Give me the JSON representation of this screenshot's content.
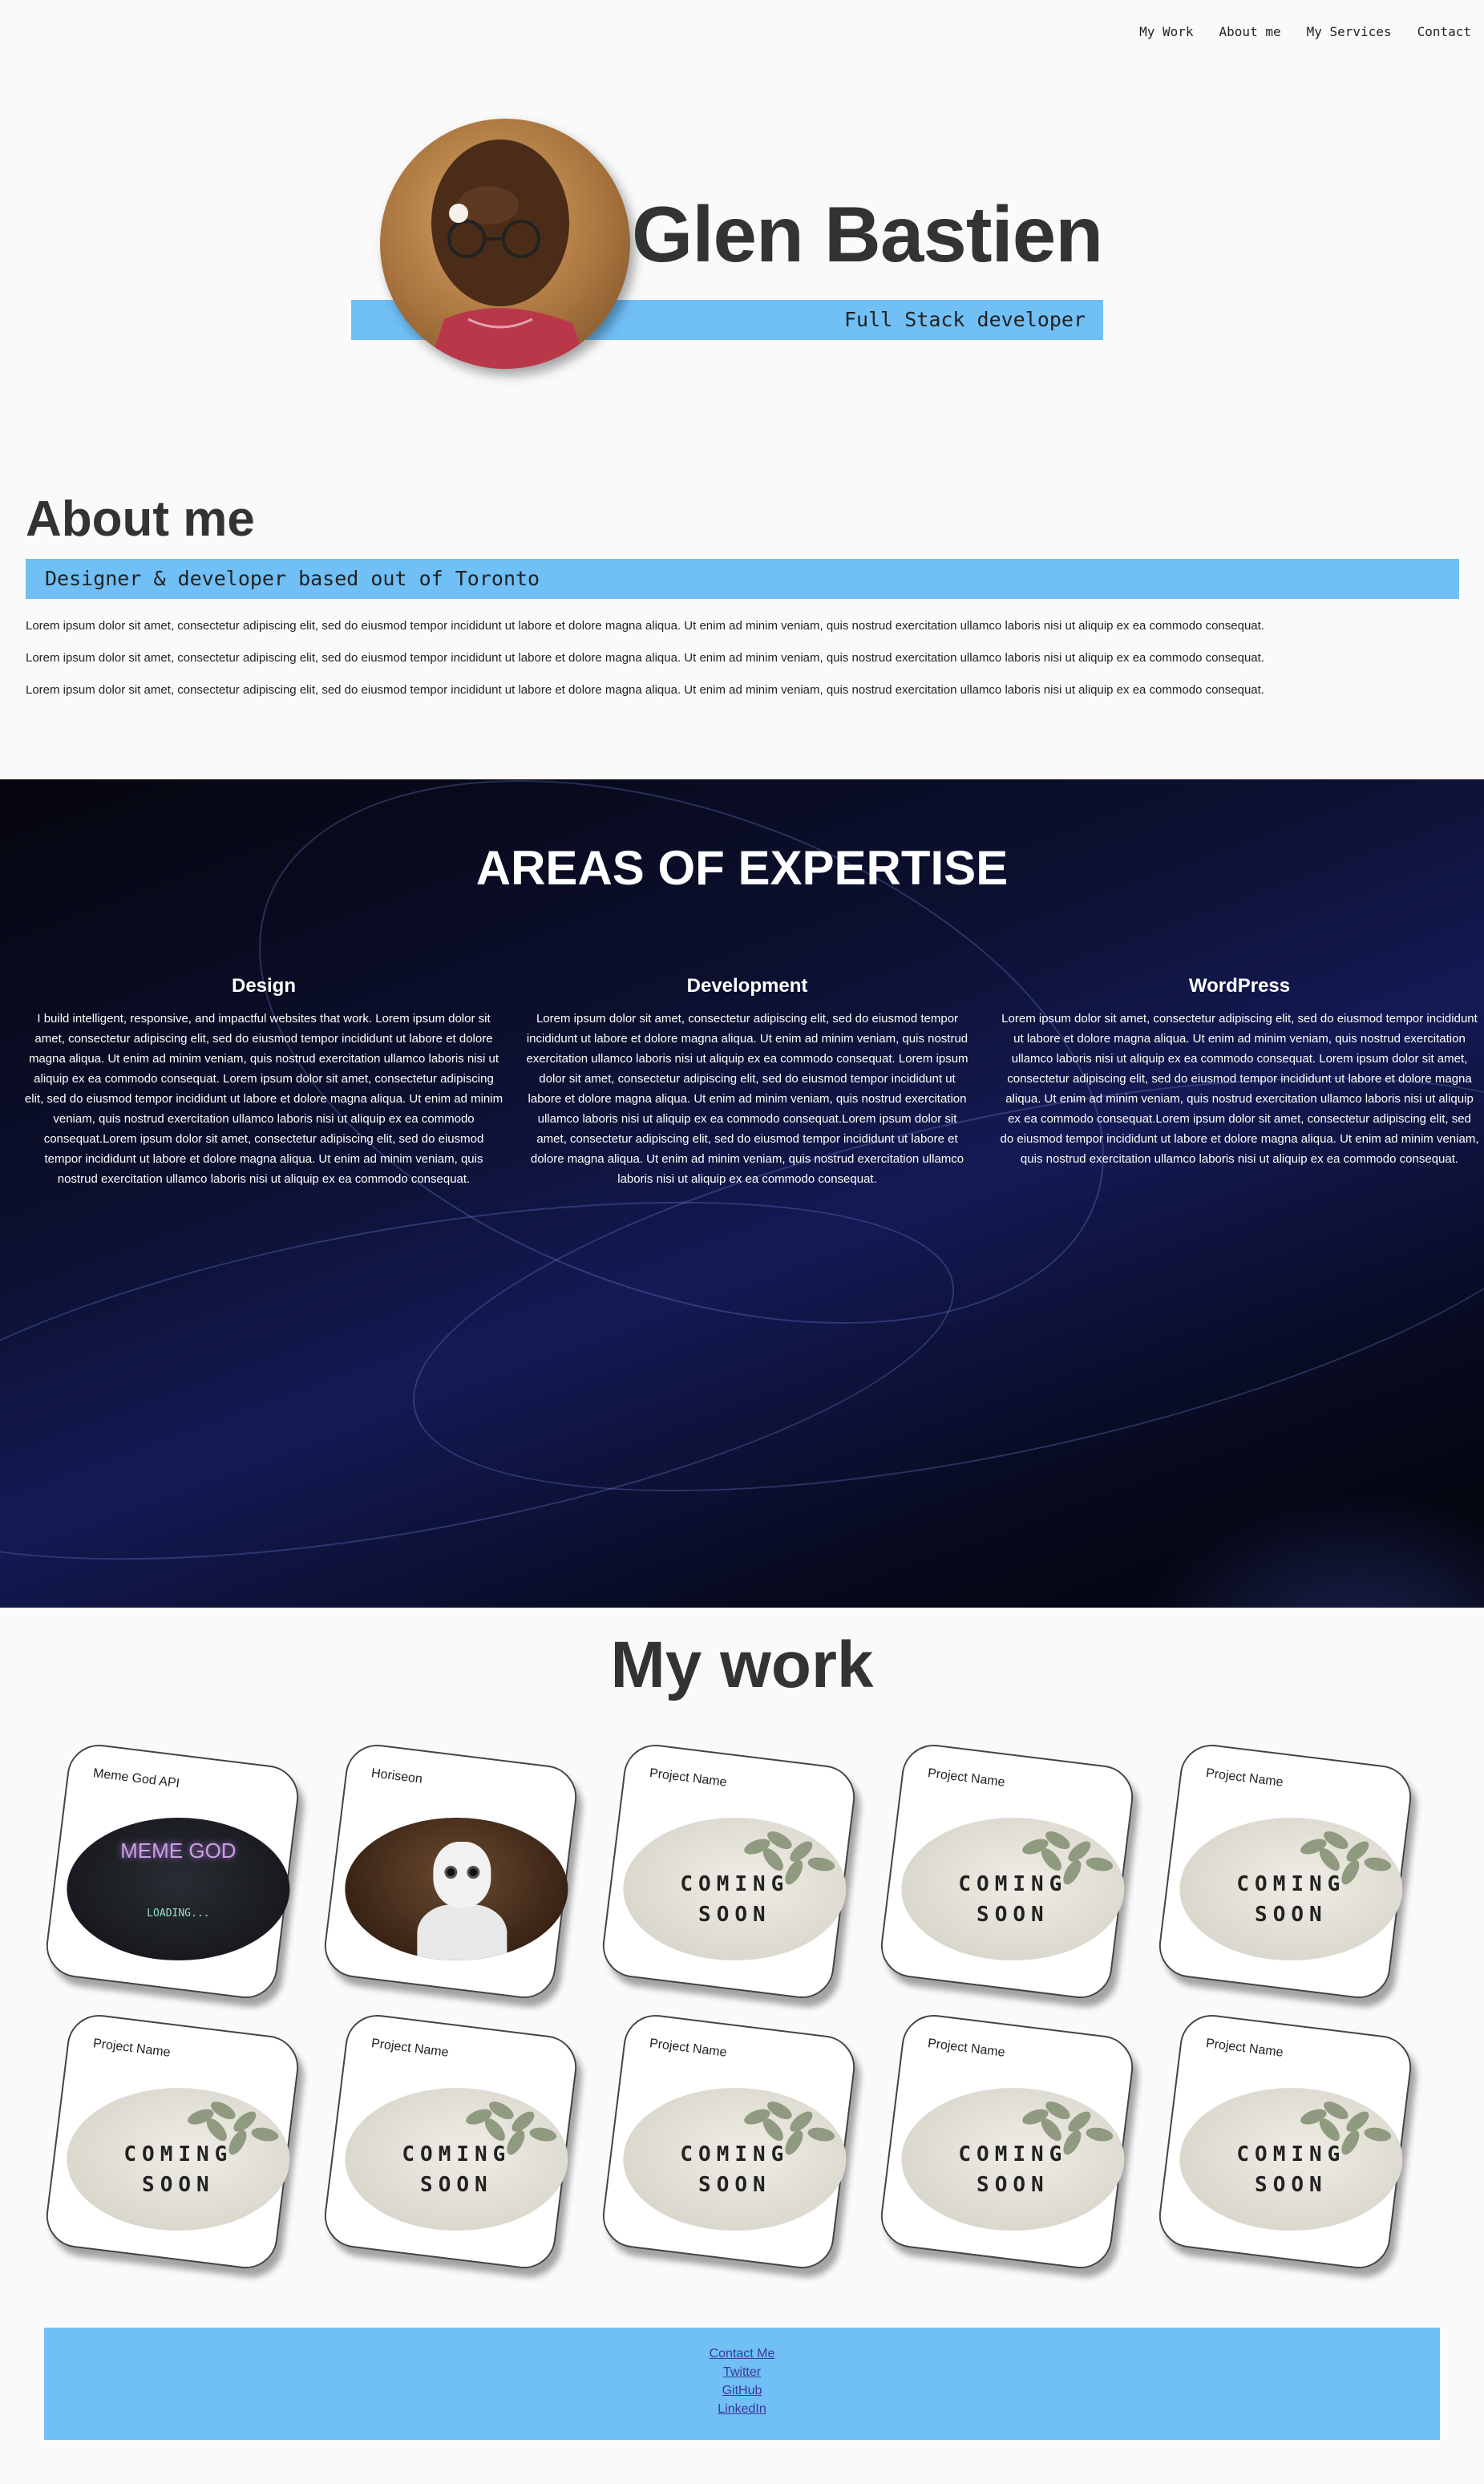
{
  "nav": {
    "items": [
      "My Work",
      "About me",
      "My Services",
      "Contact"
    ]
  },
  "hero": {
    "name": "Glen Bastien",
    "subtitle": "Full Stack developer"
  },
  "about": {
    "title": "About me",
    "tagline": "Designer & developer based out of Toronto",
    "paragraphs": [
      "Lorem ipsum dolor sit amet, consectetur adipiscing elit, sed do eiusmod tempor incididunt ut labore et dolore magna aliqua. Ut enim ad minim veniam, quis nostrud exercitation ullamco laboris nisi ut aliquip ex ea commodo consequat.",
      "Lorem ipsum dolor sit amet, consectetur adipiscing elit, sed do eiusmod tempor incididunt ut labore et dolore magna aliqua. Ut enim ad minim veniam, quis nostrud exercitation ullamco laboris nisi ut aliquip ex ea commodo consequat.",
      "Lorem ipsum dolor sit amet, consectetur adipiscing elit, sed do eiusmod tempor incididunt ut labore et dolore magna aliqua. Ut enim ad minim veniam, quis nostrud exercitation ullamco laboris nisi ut aliquip ex ea commodo consequat."
    ]
  },
  "expertise": {
    "title": "AREAS OF EXPERTISE",
    "columns": [
      {
        "heading": "Design",
        "text": "I build intelligent, responsive, and impactful websites that work. Lorem ipsum dolor sit amet, consectetur adipiscing elit, sed do eiusmod tempor incididunt ut labore et dolore magna aliqua. Ut enim ad minim veniam, quis nostrud exercitation ullamco laboris nisi ut aliquip ex ea commodo consequat. Lorem ipsum dolor sit amet, consectetur adipiscing elit, sed do eiusmod tempor incididunt ut labore et dolore magna aliqua. Ut enim ad minim veniam, quis nostrud exercitation ullamco laboris nisi ut aliquip ex ea commodo consequat.Lorem ipsum dolor sit amet, consectetur adipiscing elit, sed do eiusmod tempor incididunt ut labore et dolore magna aliqua. Ut enim ad minim veniam, quis nostrud exercitation ullamco laboris nisi ut aliquip ex ea commodo consequat."
      },
      {
        "heading": "Development",
        "text": "Lorem ipsum dolor sit amet, consectetur adipiscing elit, sed do eiusmod tempor incididunt ut labore et dolore magna aliqua. Ut enim ad minim veniam, quis nostrud exercitation ullamco laboris nisi ut aliquip ex ea commodo consequat. Lorem ipsum dolor sit amet, consectetur adipiscing elit, sed do eiusmod tempor incididunt ut labore et dolore magna aliqua. Ut enim ad minim veniam, quis nostrud exercitation ullamco laboris nisi ut aliquip ex ea commodo consequat.Lorem ipsum dolor sit amet, consectetur adipiscing elit, sed do eiusmod tempor incididunt ut labore et dolore magna aliqua. Ut enim ad minim veniam, quis nostrud exercitation ullamco laboris nisi ut aliquip ex ea commodo consequat."
      },
      {
        "heading": "WordPress",
        "text": "Lorem ipsum dolor sit amet, consectetur adipiscing elit, sed do eiusmod tempor incididunt ut labore et dolore magna aliqua. Ut enim ad minim veniam, quis nostrud exercitation ullamco laboris nisi ut aliquip ex ea commodo consequat. Lorem ipsum dolor sit amet, consectetur adipiscing elit, sed do eiusmod tempor incididunt ut labore et dolore magna aliqua. Ut enim ad minim veniam, quis nostrud exercitation ullamco laboris nisi ut aliquip ex ea commodo consequat.Lorem ipsum dolor sit amet, consectetur adipiscing elit, sed do eiusmod tempor incididunt ut labore et dolore magna aliqua. Ut enim ad minim veniam, quis nostrud exercitation ullamco laboris nisi ut aliquip ex ea commodo consequat."
      }
    ]
  },
  "work": {
    "title": "My work",
    "projects": [
      {
        "name": "Meme God API",
        "thumb": "meme",
        "thumb_title": "MEME GOD",
        "thumb_status": "LOADING..."
      },
      {
        "name": "Horiseon",
        "thumb": "robot"
      },
      {
        "name": "Project Name",
        "thumb": "soon",
        "line1": "COMING",
        "line2": "SOON"
      },
      {
        "name": "Project Name",
        "thumb": "soon",
        "line1": "COMING",
        "line2": "SOON"
      },
      {
        "name": "Project Name",
        "thumb": "soon",
        "line1": "COMING",
        "line2": "SOON"
      },
      {
        "name": "Project Name",
        "thumb": "soon",
        "line1": "COMING",
        "line2": "SOON"
      },
      {
        "name": "Project Name",
        "thumb": "soon",
        "line1": "COMING",
        "line2": "SOON"
      },
      {
        "name": "Project Name",
        "thumb": "soon",
        "line1": "COMING",
        "line2": "SOON"
      },
      {
        "name": "Project Name",
        "thumb": "soon",
        "line1": "COMING",
        "line2": "SOON"
      },
      {
        "name": "Project Name",
        "thumb": "soon",
        "line1": "COMING",
        "line2": "SOON"
      }
    ]
  },
  "footer": {
    "links": [
      "Contact Me",
      "Twitter",
      "GitHub",
      "LinkedIn"
    ]
  },
  "colors": {
    "accent": "#70bff5",
    "text": "#333333",
    "link": "#3a3a9a"
  }
}
